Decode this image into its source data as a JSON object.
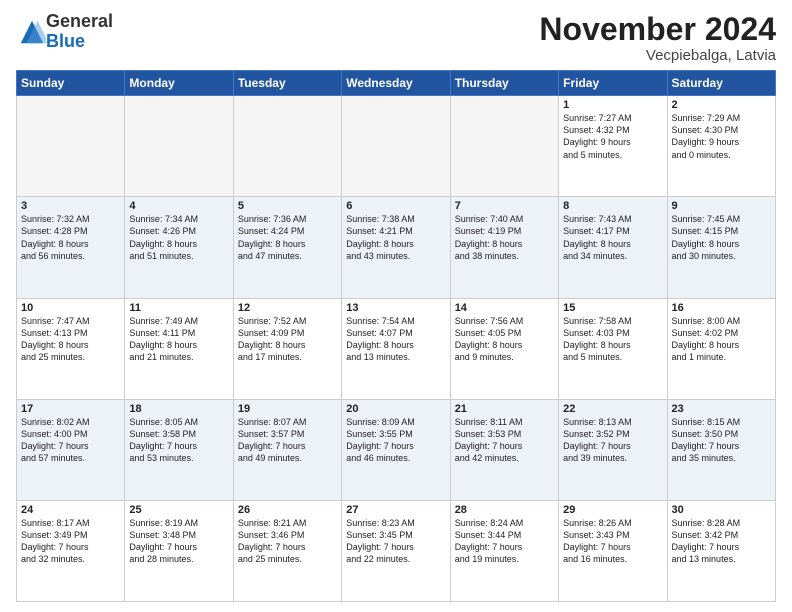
{
  "logo": {
    "general": "General",
    "blue": "Blue"
  },
  "title": "November 2024",
  "location": "Vecpiebalga, Latvia",
  "weekdays": [
    "Sunday",
    "Monday",
    "Tuesday",
    "Wednesday",
    "Thursday",
    "Friday",
    "Saturday"
  ],
  "weeks": [
    [
      {
        "day": "",
        "info": ""
      },
      {
        "day": "",
        "info": ""
      },
      {
        "day": "",
        "info": ""
      },
      {
        "day": "",
        "info": ""
      },
      {
        "day": "",
        "info": ""
      },
      {
        "day": "1",
        "info": "Sunrise: 7:27 AM\nSunset: 4:32 PM\nDaylight: 9 hours\nand 5 minutes."
      },
      {
        "day": "2",
        "info": "Sunrise: 7:29 AM\nSunset: 4:30 PM\nDaylight: 9 hours\nand 0 minutes."
      }
    ],
    [
      {
        "day": "3",
        "info": "Sunrise: 7:32 AM\nSunset: 4:28 PM\nDaylight: 8 hours\nand 56 minutes."
      },
      {
        "day": "4",
        "info": "Sunrise: 7:34 AM\nSunset: 4:26 PM\nDaylight: 8 hours\nand 51 minutes."
      },
      {
        "day": "5",
        "info": "Sunrise: 7:36 AM\nSunset: 4:24 PM\nDaylight: 8 hours\nand 47 minutes."
      },
      {
        "day": "6",
        "info": "Sunrise: 7:38 AM\nSunset: 4:21 PM\nDaylight: 8 hours\nand 43 minutes."
      },
      {
        "day": "7",
        "info": "Sunrise: 7:40 AM\nSunset: 4:19 PM\nDaylight: 8 hours\nand 38 minutes."
      },
      {
        "day": "8",
        "info": "Sunrise: 7:43 AM\nSunset: 4:17 PM\nDaylight: 8 hours\nand 34 minutes."
      },
      {
        "day": "9",
        "info": "Sunrise: 7:45 AM\nSunset: 4:15 PM\nDaylight: 8 hours\nand 30 minutes."
      }
    ],
    [
      {
        "day": "10",
        "info": "Sunrise: 7:47 AM\nSunset: 4:13 PM\nDaylight: 8 hours\nand 25 minutes."
      },
      {
        "day": "11",
        "info": "Sunrise: 7:49 AM\nSunset: 4:11 PM\nDaylight: 8 hours\nand 21 minutes."
      },
      {
        "day": "12",
        "info": "Sunrise: 7:52 AM\nSunset: 4:09 PM\nDaylight: 8 hours\nand 17 minutes."
      },
      {
        "day": "13",
        "info": "Sunrise: 7:54 AM\nSunset: 4:07 PM\nDaylight: 8 hours\nand 13 minutes."
      },
      {
        "day": "14",
        "info": "Sunrise: 7:56 AM\nSunset: 4:05 PM\nDaylight: 8 hours\nand 9 minutes."
      },
      {
        "day": "15",
        "info": "Sunrise: 7:58 AM\nSunset: 4:03 PM\nDaylight: 8 hours\nand 5 minutes."
      },
      {
        "day": "16",
        "info": "Sunrise: 8:00 AM\nSunset: 4:02 PM\nDaylight: 8 hours\nand 1 minute."
      }
    ],
    [
      {
        "day": "17",
        "info": "Sunrise: 8:02 AM\nSunset: 4:00 PM\nDaylight: 7 hours\nand 57 minutes."
      },
      {
        "day": "18",
        "info": "Sunrise: 8:05 AM\nSunset: 3:58 PM\nDaylight: 7 hours\nand 53 minutes."
      },
      {
        "day": "19",
        "info": "Sunrise: 8:07 AM\nSunset: 3:57 PM\nDaylight: 7 hours\nand 49 minutes."
      },
      {
        "day": "20",
        "info": "Sunrise: 8:09 AM\nSunset: 3:55 PM\nDaylight: 7 hours\nand 46 minutes."
      },
      {
        "day": "21",
        "info": "Sunrise: 8:11 AM\nSunset: 3:53 PM\nDaylight: 7 hours\nand 42 minutes."
      },
      {
        "day": "22",
        "info": "Sunrise: 8:13 AM\nSunset: 3:52 PM\nDaylight: 7 hours\nand 39 minutes."
      },
      {
        "day": "23",
        "info": "Sunrise: 8:15 AM\nSunset: 3:50 PM\nDaylight: 7 hours\nand 35 minutes."
      }
    ],
    [
      {
        "day": "24",
        "info": "Sunrise: 8:17 AM\nSunset: 3:49 PM\nDaylight: 7 hours\nand 32 minutes."
      },
      {
        "day": "25",
        "info": "Sunrise: 8:19 AM\nSunset: 3:48 PM\nDaylight: 7 hours\nand 28 minutes."
      },
      {
        "day": "26",
        "info": "Sunrise: 8:21 AM\nSunset: 3:46 PM\nDaylight: 7 hours\nand 25 minutes."
      },
      {
        "day": "27",
        "info": "Sunrise: 8:23 AM\nSunset: 3:45 PM\nDaylight: 7 hours\nand 22 minutes."
      },
      {
        "day": "28",
        "info": "Sunrise: 8:24 AM\nSunset: 3:44 PM\nDaylight: 7 hours\nand 19 minutes."
      },
      {
        "day": "29",
        "info": "Sunrise: 8:26 AM\nSunset: 3:43 PM\nDaylight: 7 hours\nand 16 minutes."
      },
      {
        "day": "30",
        "info": "Sunrise: 8:28 AM\nSunset: 3:42 PM\nDaylight: 7 hours\nand 13 minutes."
      }
    ]
  ]
}
